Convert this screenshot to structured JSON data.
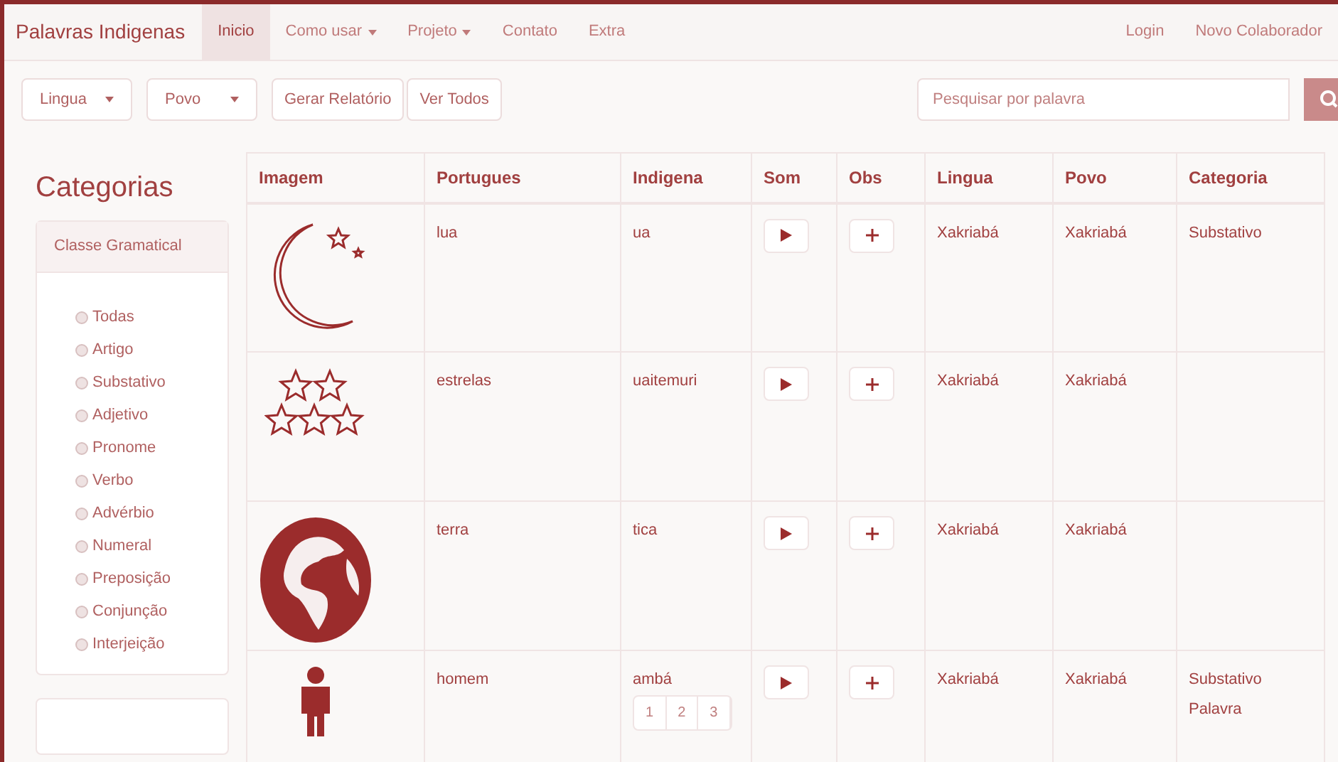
{
  "navbar": {
    "brand": "Palavras Indigenas",
    "items": [
      {
        "label": "Inicio",
        "selected": true,
        "dropdown": false
      },
      {
        "label": "Como usar",
        "selected": false,
        "dropdown": true
      },
      {
        "label": "Projeto",
        "selected": false,
        "dropdown": true
      },
      {
        "label": "Contato",
        "selected": false,
        "dropdown": false
      },
      {
        "label": "Extra",
        "selected": false,
        "dropdown": false
      }
    ],
    "right_items": [
      "Login",
      "Novo Colaborador"
    ]
  },
  "filters": {
    "selects": [
      "Lingua",
      "Povo"
    ],
    "buttons": [
      "Gerar Relatório",
      "Ver Todos"
    ],
    "search": {
      "placeholder": "Pesquisar por palavra"
    }
  },
  "sidebar": {
    "title": "Categorias",
    "panel_title": "Classe Gramatical",
    "options": [
      {
        "label": "Todas",
        "selected": false
      },
      {
        "label": "Artigo",
        "selected": false
      },
      {
        "label": "Substativo",
        "selected": false
      },
      {
        "label": "Adjetivo",
        "selected": false
      },
      {
        "label": "Pronome",
        "selected": false
      },
      {
        "label": "Verbo",
        "selected": false
      },
      {
        "label": "Advérbio",
        "selected": false
      },
      {
        "label": "Numeral",
        "selected": false
      },
      {
        "label": "Preposição",
        "selected": false
      },
      {
        "label": "Conjunção",
        "selected": false
      },
      {
        "label": "Interjeição",
        "selected": false
      }
    ]
  },
  "table": {
    "columns": [
      "Imagem",
      "Portugues",
      "Indigena",
      "Som",
      "Obs",
      "Lingua",
      "Povo",
      "Categoria"
    ],
    "rows": [
      {
        "kind": "moon",
        "portugues": "lua",
        "indigena": "ua",
        "lingua": "Xakriabá",
        "povo": "Xakriabá",
        "categoria": [
          "Substativo"
        ]
      },
      {
        "kind": "stars",
        "portugues": "estrelas",
        "indigena": "uaitemuri",
        "lingua": "Xakriabá",
        "povo": "Xakriabá",
        "categoria": []
      },
      {
        "kind": "globe",
        "portugues": "terra",
        "indigena": "tica",
        "lingua": "Xakriabá",
        "povo": "Xakriabá",
        "categoria": []
      },
      {
        "kind": "person",
        "portugues": "homem",
        "indigena": "ambá",
        "lingua": "Xakriabá",
        "povo": "Xakriabá",
        "categoria": [
          "Substativo",
          "Palavra"
        ],
        "pagination": [
          "1",
          "2",
          "3"
        ]
      }
    ]
  }
}
